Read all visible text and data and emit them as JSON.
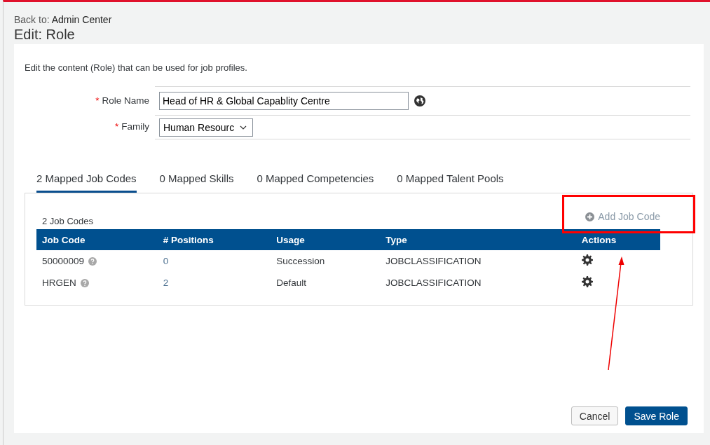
{
  "header": {
    "back_prefix": "Back to:",
    "back_link": "Admin Center",
    "title": "Edit: Role"
  },
  "description": "Edit the content (Role) that can be used for job profiles.",
  "form": {
    "fields": [
      {
        "kind": "text",
        "required_mark": "*",
        "label": "Role Name",
        "value": "Head of HR & Global Capablity Centre"
      },
      {
        "kind": "select",
        "required_mark": "*",
        "label": "Family",
        "value": "Human Resourc"
      }
    ]
  },
  "tabs": [
    {
      "label": "2 Mapped Job Codes",
      "selected": true
    },
    {
      "label": "0 Mapped Skills",
      "selected": false
    },
    {
      "label": "0 Mapped Competencies",
      "selected": false
    },
    {
      "label": "0 Mapped Talent Pools",
      "selected": false
    }
  ],
  "panel": {
    "count": "2 Job Codes",
    "add_button": "Add Job Code",
    "table": {
      "columns": [
        "Job Code",
        "# Positions",
        "Usage",
        "Type",
        "Actions"
      ],
      "rows": [
        {
          "job_code": "50000009",
          "positions": "0",
          "usage": "Succession",
          "type": "JOBCLASSIFICATION"
        },
        {
          "job_code": "HRGEN",
          "positions": "2",
          "usage": "Default",
          "type": "JOBCLASSIFICATION"
        }
      ]
    }
  },
  "buttons": [
    {
      "kind": "secondary",
      "label": "Cancel"
    },
    {
      "kind": "primary",
      "label": "Save Role"
    }
  ]
}
